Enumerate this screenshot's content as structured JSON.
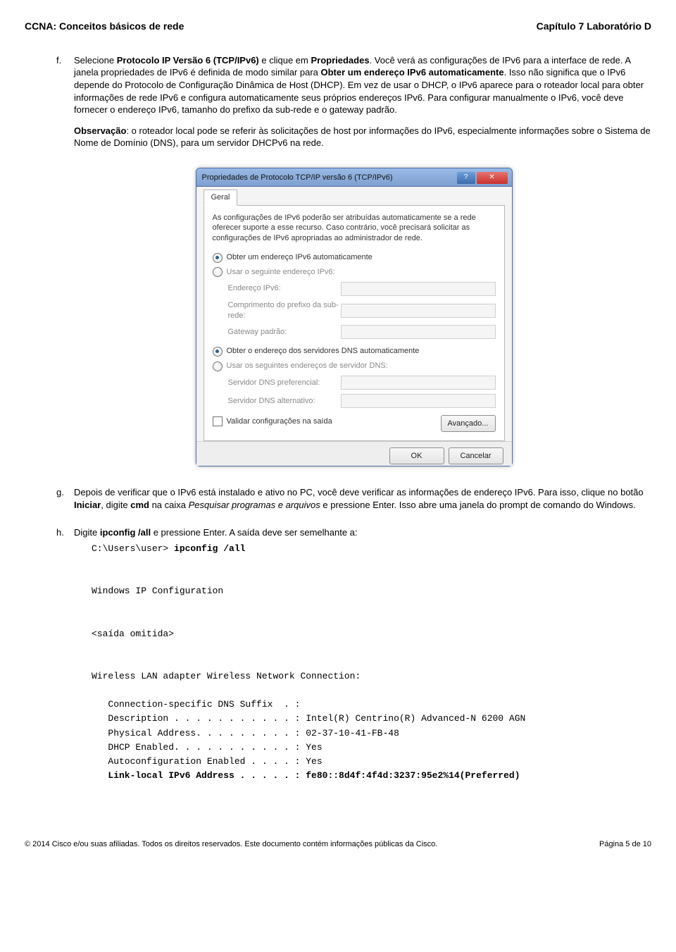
{
  "header": {
    "left": "CCNA: Conceitos básicos de rede",
    "right": "Capítulo 7 Laboratório D"
  },
  "step_f": {
    "marker": "f.",
    "p1_a": "Selecione ",
    "p1_b": "Protocolo IP Versão 6 (TCP/IPv6)",
    "p1_c": " e clique em ",
    "p1_d": "Propriedades",
    "p1_e": ". Você verá as configurações de IPv6 para a interface de rede. A janela propriedades de IPv6 é definida de modo similar para ",
    "p1_f": "Obter um endereço IPv6 automaticamente",
    "p1_g": ". Isso não significa que o IPv6 depende do Protocolo de Configuração Dinâmica de Host (DHCP). Em vez de usar o DHCP, o IPv6 aparece para o roteador local para obter informações de rede IPv6 e configura automaticamente seus próprios endereços IPv6. Para configurar manualmente o IPv6, você deve fornecer o endereço IPv6, tamanho do prefixo da sub-rede e o gateway padrão.",
    "p2_a": "Observação",
    "p2_b": ": o roteador local pode se referir às solicitações de host por informações do IPv6, especialmente informações sobre o Sistema de Nome de Domínio (DNS), para um servidor DHCPv6 na rede."
  },
  "dialog": {
    "title": "Propriedades de Protocolo TCP/IP versão 6 (TCP/IPv6)",
    "tab": "Geral",
    "desc": "As configurações de IPv6 poderão ser atribuídas automaticamente se a rede oferecer suporte a esse recurso. Caso contrário, você precisará solicitar as configurações de IPv6 apropriadas ao administrador de rede.",
    "radio_auto_ip": "Obter um endereço IPv6 automaticamente",
    "radio_manual_ip": "Usar o seguinte endereço IPv6:",
    "field_addr": "Endereço IPv6:",
    "field_prefix": "Comprimento do prefixo da sub-rede:",
    "field_gw": "Gateway padrão:",
    "radio_auto_dns": "Obter o endereço dos servidores DNS automaticamente",
    "radio_manual_dns": "Usar os seguintes endereços de servidor DNS:",
    "field_dns_pref": "Servidor DNS preferencial:",
    "field_dns_alt": "Servidor DNS alternativo:",
    "check_validate": "Validar configurações na saída",
    "btn_adv": "Avançado...",
    "btn_ok": "OK",
    "btn_cancel": "Cancelar"
  },
  "step_g": {
    "marker": "g.",
    "a": "Depois de verificar que o IPv6 está instalado e ativo no PC, você deve verificar as informações de endereço IPv6. Para isso, clique no botão ",
    "b": "Iniciar",
    "c": ", digite ",
    "d": "cmd",
    "e": " na caixa ",
    "f": "Pesquisar programas e arquivos",
    "g": " e pressione Enter. Isso abre uma janela do prompt de comando do Windows."
  },
  "step_h": {
    "marker": "h.",
    "a": "Digite ",
    "b": "ipconfig /all",
    "c": " e pressione Enter. A saída deve ser semelhante a:"
  },
  "console": {
    "prompt": "C:\\Users\\user> ",
    "cmd": "ipconfig /all",
    "line1": "Windows IP Configuration",
    "line2": "<saída omitida>",
    "line3": "Wireless LAN adapter Wireless Network Connection:",
    "c1": "   Connection-specific DNS Suffix  . :",
    "c2": "   Description . . . . . . . . . . . : Intel(R) Centrino(R) Advanced-N 6200 AGN",
    "c3": "   Physical Address. . . . . . . . . : 02-37-10-41-FB-48",
    "c4": "   DHCP Enabled. . . . . . . . . . . : Yes",
    "c5": "   Autoconfiguration Enabled . . . . : Yes",
    "c6a": "   Link-local IPv6 Address . . . . . : ",
    "c6b": "fe80::8d4f:4f4d:3237:95e2%14(Preferred)"
  },
  "footer": {
    "left": "© 2014 Cisco e/ou suas afiliadas. Todos os direitos reservados. Este documento contém informações públicas da Cisco.",
    "right": "Página 5 de 10"
  }
}
